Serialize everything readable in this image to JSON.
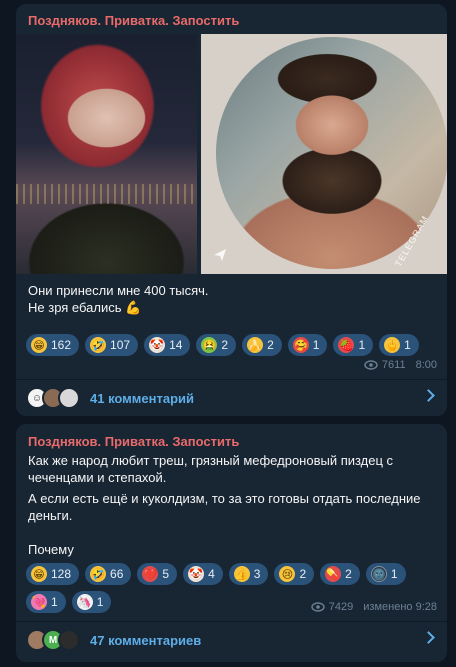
{
  "posts": [
    {
      "channel": "Поздняков. Приватка. Запостить",
      "text_lines": [
        "Они принесли мне 400 тысяч.",
        "Не зря ебались 💪"
      ],
      "reactions": [
        {
          "emoji": "😁",
          "count": "162",
          "color": "yellow"
        },
        {
          "emoji": "🤣",
          "count": "107",
          "color": "yellow"
        },
        {
          "emoji": "🤡",
          "count": "14",
          "color": "clown"
        },
        {
          "emoji": "🤮",
          "count": "2",
          "color": "green"
        },
        {
          "emoji": "🍌",
          "count": "2",
          "color": "yellow"
        },
        {
          "emoji": "🥰",
          "count": "1",
          "color": "red"
        },
        {
          "emoji": "🍓",
          "count": "1",
          "color": "red"
        },
        {
          "emoji": "🖕",
          "count": "1",
          "color": "yellow"
        }
      ],
      "views": "7611",
      "time": "8:00",
      "comments_label": "41 комментарий",
      "watermark": "TELEGRAM"
    },
    {
      "channel": "Поздняков. Приватка. Запостить",
      "text_lines": [
        "Как же народ любит треш, грязный мефедроновый пиздец с",
        "чеченцами и степахой.",
        "А если есть ещё и куколдизм, то  за это готовы отдать последние",
        "деньги.",
        "",
        "Почему"
      ],
      "reactions": [
        {
          "emoji": "😁",
          "count": "128",
          "color": "yellow"
        },
        {
          "emoji": "🤣",
          "count": "66",
          "color": "yellow"
        },
        {
          "emoji": "💔",
          "count": "5",
          "color": "red"
        },
        {
          "emoji": "🤡",
          "count": "4",
          "color": "clown"
        },
        {
          "emoji": "👍",
          "count": "3",
          "color": "yellow"
        },
        {
          "emoji": "😢",
          "count": "2",
          "color": "yellow"
        },
        {
          "emoji": "💊",
          "count": "2",
          "color": "red"
        },
        {
          "emoji": "🌚",
          "count": "1",
          "color": "gray"
        },
        {
          "emoji": "💘",
          "count": "1",
          "color": "pink"
        },
        {
          "emoji": "🦄",
          "count": "1",
          "color": "white"
        }
      ],
      "views": "7429",
      "edited_time": "изменено 9:28",
      "comments_label": "47 комментариев",
      "comment_avatar_letter": "M"
    }
  ],
  "colors": {
    "background": "#0e1621",
    "card": "#182533",
    "channel_name": "#e86a6a",
    "link": "#5eaee7",
    "reaction_bg": "#2b5278",
    "meta": "#6d8194"
  }
}
